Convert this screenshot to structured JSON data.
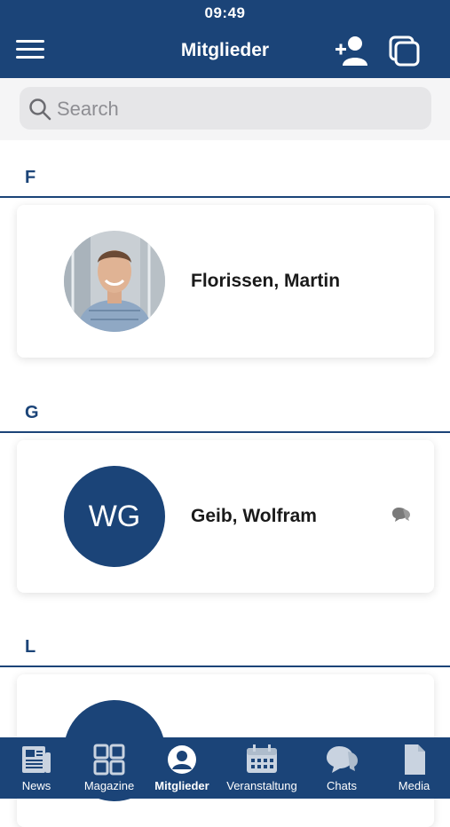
{
  "status_bar": {
    "time": "09:49"
  },
  "header": {
    "title": "Mitglieder"
  },
  "search": {
    "placeholder": "Search"
  },
  "sections": [
    {
      "letter": "F",
      "members": [
        {
          "name": "Florissen, Martin",
          "avatar": "photo"
        }
      ]
    },
    {
      "letter": "G",
      "members": [
        {
          "name": "Geib, Wolfram",
          "initials": "WG",
          "avatar": "initials"
        }
      ]
    },
    {
      "letter": "L",
      "members": [
        {
          "avatar": "initials"
        }
      ]
    }
  ],
  "tabs": [
    {
      "label": "News",
      "icon": "news-icon"
    },
    {
      "label": "Magazine",
      "icon": "grid-icon"
    },
    {
      "label": "Mitglieder",
      "icon": "member-icon",
      "active": true
    },
    {
      "label": "Veranstaltung",
      "icon": "calendar-icon"
    },
    {
      "label": "Chats",
      "icon": "chat-icon"
    },
    {
      "label": "Media",
      "icon": "document-icon"
    }
  ],
  "colors": {
    "primary": "#1b4478",
    "background": "#ffffff",
    "search_bg": "#e6e6e8"
  }
}
